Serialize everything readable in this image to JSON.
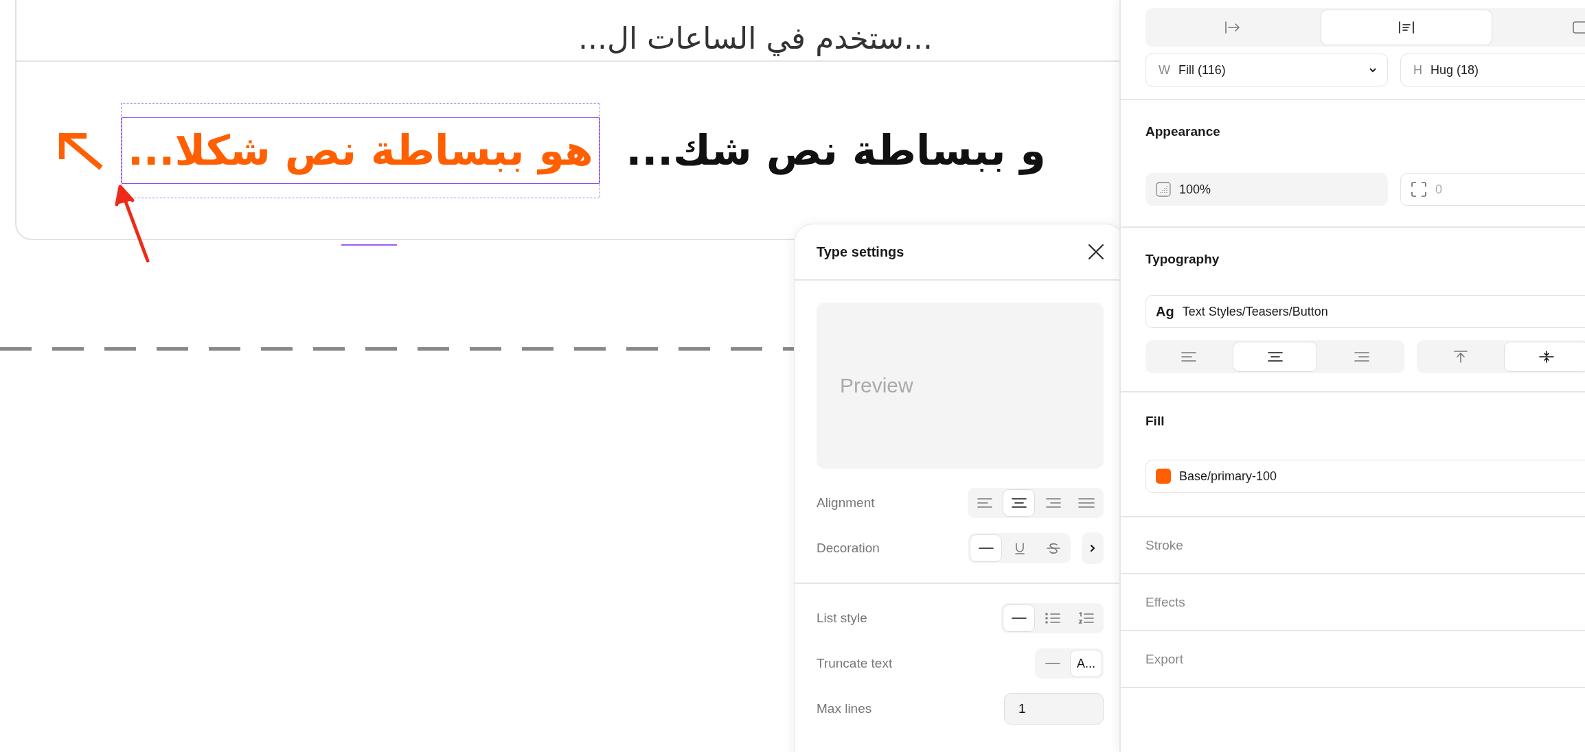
{
  "canvas": {
    "top_text": "...ستخدم في الساعات ال...",
    "selected_text": "هو ببساطة نص شكلا...",
    "next_text": "و ببساطة نص شك..."
  },
  "type_settings": {
    "title": "Type settings",
    "preview": "Preview",
    "groups": [
      {
        "rows": [
          {
            "kind": "segmented",
            "label": "Alignment",
            "more": false,
            "options": [
              {
                "kind": "left",
                "selected": false
              },
              {
                "kind": "center",
                "selected": true
              },
              {
                "kind": "right",
                "selected": false
              },
              {
                "kind": "justify",
                "selected": false
              }
            ]
          },
          {
            "kind": "segmented",
            "label": "Decoration",
            "more": true,
            "options": [
              {
                "kind": "none",
                "selected": true
              },
              {
                "kind": "underline",
                "selected": false
              },
              {
                "kind": "strike",
                "selected": false
              }
            ]
          }
        ]
      },
      {
        "rows": [
          {
            "kind": "segmented",
            "label": "List style",
            "more": false,
            "options": [
              {
                "kind": "none",
                "selected": true
              },
              {
                "kind": "bullets",
                "selected": false
              },
              {
                "kind": "numbers",
                "selected": false
              }
            ]
          },
          {
            "kind": "segmented",
            "label": "Truncate text",
            "more": false,
            "options": [
              {
                "kind": "none",
                "selected": false
              },
              {
                "kind": "text",
                "label": "A...",
                "selected": true
              }
            ]
          },
          {
            "kind": "input",
            "label": "Max lines",
            "value": "1"
          }
        ]
      }
    ]
  },
  "inspector": {
    "layout_options": [
      {
        "kind": "fixed",
        "selected": false
      },
      {
        "kind": "fill",
        "selected": true
      },
      {
        "kind": "hug",
        "selected": false
      }
    ],
    "size_fields": [
      {
        "axis": "W",
        "value": "Fill (116)",
        "dropdown": true
      },
      {
        "axis": "H",
        "value": "Hug (18)",
        "dropdown": false
      }
    ],
    "sections": [
      {
        "kind": "appearance",
        "title": "Appearance",
        "opacity": "100%",
        "radius_placeholder": "0"
      },
      {
        "kind": "typography",
        "title": "Typography",
        "style": {
          "badge": "Ag",
          "name": "Text Styles/Teasers/Button"
        },
        "align_h": [
          {
            "kind": "left",
            "selected": false
          },
          {
            "kind": "center",
            "selected": true
          },
          {
            "kind": "right",
            "selected": false
          }
        ],
        "align_v": [
          {
            "kind": "top",
            "selected": false
          },
          {
            "kind": "middle",
            "selected": true
          }
        ]
      },
      {
        "kind": "fill",
        "title": "Fill",
        "fill": {
          "color": "#ff5f00",
          "name": "Base/primary-100"
        }
      },
      {
        "kind": "empty",
        "title": "Stroke"
      },
      {
        "kind": "empty",
        "title": "Effects"
      },
      {
        "kind": "empty",
        "title": "Export"
      }
    ]
  }
}
